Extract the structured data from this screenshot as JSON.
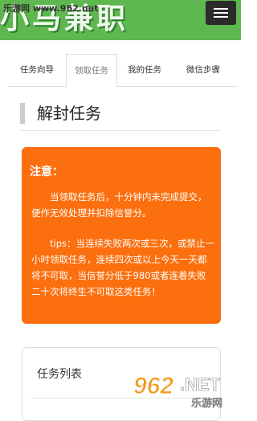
{
  "header": {
    "watermark": "乐游网 www.962.net",
    "brand": "小马兼职",
    "menu_icon": "hamburger-icon",
    "bg_color": "#5fb84f"
  },
  "tabs": [
    {
      "label": "任务向导",
      "active": false
    },
    {
      "label": "领取任务",
      "active": true
    },
    {
      "label": "我的任务",
      "active": false
    },
    {
      "label": "微信步骤",
      "active": false
    }
  ],
  "section": {
    "title": "解封任务"
  },
  "notice": {
    "heading": "注意：",
    "paragraph1": "当领取任务后，十分钟内未完成提交，便作无效处理并扣除信誉分。",
    "paragraph2": "tips：当连续失败两次或三次，或禁止一小时领取任务，连续四次或以上今天一天都将不可取，当信誉分低于980或者连着失败二十次将终生不可取这类任务！",
    "bg_color": "#fb6f0e"
  },
  "task_list": {
    "title": "任务列表"
  },
  "watermark_logo": {
    "number": "962",
    "suffix": ".NET",
    "name": "乐游网"
  }
}
